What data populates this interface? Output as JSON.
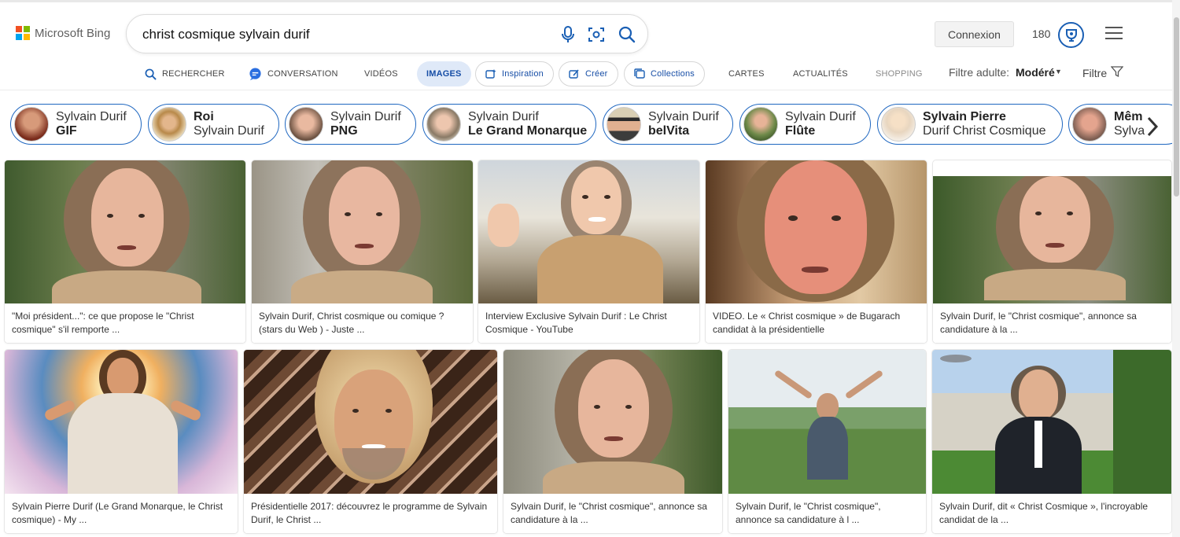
{
  "brand": {
    "name": "Microsoft Bing",
    "colors": [
      "#f25022",
      "#7fba00",
      "#00a4ef",
      "#ffb900"
    ]
  },
  "search": {
    "query": "christ cosmique sylvain durif",
    "icons": [
      "microphone-icon",
      "visual-search-icon",
      "search-icon"
    ]
  },
  "account": {
    "signin_label": "Connexion",
    "rewards_points": "180"
  },
  "nav": {
    "tabs": [
      {
        "label": "RECHERCHER",
        "icon": "search-icon"
      },
      {
        "label": "CONVERSATION",
        "icon": "copilot-chat-icon"
      },
      {
        "label": "VIDÉOS"
      },
      {
        "label": "IMAGES",
        "active": true
      },
      {
        "label": "Inspiration",
        "icon": "sparkle-image-icon"
      },
      {
        "label": "Créer",
        "icon": "create-image-icon"
      },
      {
        "label": "Collections",
        "icon": "collections-icon"
      },
      {
        "label": "CARTES"
      },
      {
        "label": "ACTUALITÉS"
      },
      {
        "label": "SHOPPING"
      }
    ],
    "adult_filter_label": "Filtre adulte:",
    "adult_filter_value": "Modéré",
    "filter_label": "Filtre"
  },
  "related": [
    {
      "line1": "Sylvain Durif",
      "line2": "GIF",
      "bold": 2
    },
    {
      "line1": "Roi",
      "line2": "Sylvain Durif",
      "bold": 1
    },
    {
      "line1": "Sylvain Durif",
      "line2": "PNG",
      "bold": 2
    },
    {
      "line1": "Sylvain Durif",
      "line2": "Le Grand Monarque",
      "bold": 2
    },
    {
      "line1": "Sylvain Durif",
      "line2": "belVita",
      "bold": 2
    },
    {
      "line1": "Sylvain Durif",
      "line2": "Flûte",
      "bold": 2
    },
    {
      "line1": "Sylvain Pierre",
      "line2": "Durif Christ Cosmique",
      "bold": 1
    },
    {
      "line1": "Mêm",
      "line2": "Sylva",
      "bold": 1
    }
  ],
  "results": [
    {
      "caption": "\"Moi président...\": ce que propose le \"Christ cosmique\" s'il remporte ..."
    },
    {
      "caption": "Sylvain Durif, Christ cosmique ou comique ? (stars du Web ) - Juste ..."
    },
    {
      "caption": "Interview Exclusive Sylvain Durif : Le Christ Cosmique - YouTube"
    },
    {
      "caption": "VIDEO. Le « Christ cosmique » de Bugarach candidat à la présidentielle"
    },
    {
      "caption": "Sylvain Durif, le \"Christ cosmique\", annonce sa candidature à la ..."
    },
    {
      "caption": "Sylvain Pierre Durif (Le Grand Monarque, le Christ cosmique) - My ..."
    },
    {
      "caption": "Présidentielle 2017: découvrez le programme de Sylvain Durif, le Christ ..."
    },
    {
      "caption": "Sylvain Durif, le \"Christ cosmique\", annonce sa candidature à la ..."
    },
    {
      "caption": "Sylvain Durif, le \"Christ cosmique\", annonce sa candidature à l ..."
    },
    {
      "caption": "Sylvain Durif, dit « Christ Cosmique », l'incroyable candidat de la ..."
    }
  ]
}
